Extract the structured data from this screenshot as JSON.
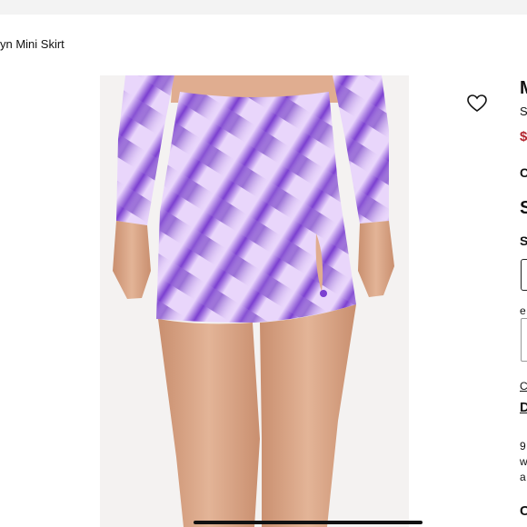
{
  "breadcrumb": {
    "text": "yn Mini Skirt"
  },
  "product_image": {
    "alt_subject": "purple checkered mini skirt with side slit"
  },
  "wishlist": {
    "icon": "heart-outline-icon"
  },
  "details_panel": {
    "title_initial": "M",
    "subtitle_initial": "S",
    "price_initial": "$",
    "color_initial": "C",
    "size_header_initial": "S",
    "size_label_initial": "S",
    "email_initial": "e",
    "link_initial": "C",
    "description_initial": "D",
    "line1_initial": "9",
    "line2_initial": "w",
    "line3_initial": "a",
    "bottom_initial": "C"
  },
  "colors": {
    "price": "#b3232d",
    "purple_dark": "#6a2fc2",
    "purple_light": "#e2c9f7"
  }
}
